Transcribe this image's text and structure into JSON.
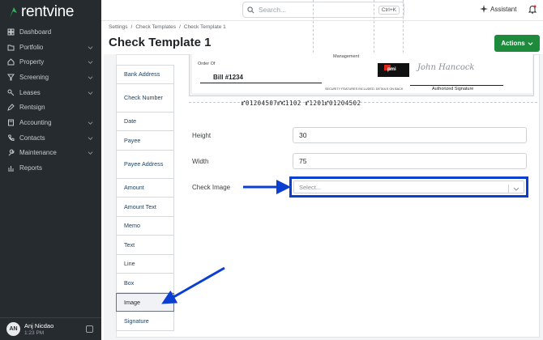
{
  "app": {
    "brand": "rentvine",
    "brand_color": "#1d8a3c",
    "accent_color": "#0b3fd1"
  },
  "sidebar": {
    "items": [
      {
        "label": "Dashboard",
        "icon": "grid-icon",
        "has_chevron": false
      },
      {
        "label": "Portfolio",
        "icon": "folder-icon",
        "has_chevron": true
      },
      {
        "label": "Property",
        "icon": "home-icon",
        "has_chevron": true
      },
      {
        "label": "Screening",
        "icon": "filter-icon",
        "has_chevron": true
      },
      {
        "label": "Leases",
        "icon": "key-icon",
        "has_chevron": true
      },
      {
        "label": "Rentsign",
        "icon": "pen-icon",
        "has_chevron": false
      },
      {
        "label": "Accounting",
        "icon": "calculator-icon",
        "has_chevron": true
      },
      {
        "label": "Contacts",
        "icon": "phone-icon",
        "has_chevron": true
      },
      {
        "label": "Maintenance",
        "icon": "wrench-icon",
        "has_chevron": true
      },
      {
        "label": "Reports",
        "icon": "chart-icon",
        "has_chevron": false
      }
    ],
    "user": {
      "initials": "AN",
      "name": "Anj Nicdao",
      "time": "1:23 PM"
    }
  },
  "header": {
    "search_placeholder": "Search...",
    "search_shortcut": "Ctrl+K",
    "assistant_label": "Assistant"
  },
  "breadcrumb": [
    "Settings",
    "/",
    "Check Templates",
    "/",
    "Check Template 1"
  ],
  "page": {
    "title": "Check Template 1",
    "actions_label": "Actions"
  },
  "fields": [
    {
      "label": "Bank Address",
      "tall": false,
      "selected": false
    },
    {
      "label": "Check Number",
      "tall": true,
      "selected": false
    },
    {
      "label": "Date",
      "tall": false,
      "selected": false
    },
    {
      "label": "Payee",
      "tall": false,
      "selected": false
    },
    {
      "label": "Payee Address",
      "tall": true,
      "selected": false
    },
    {
      "label": "Amount",
      "tall": false,
      "selected": false
    },
    {
      "label": "Amount Text",
      "tall": false,
      "selected": false
    },
    {
      "label": "Memo",
      "tall": false,
      "selected": false
    },
    {
      "label": "Text",
      "tall": false,
      "selected": false
    },
    {
      "label": "Line",
      "tall": false,
      "selected": false
    },
    {
      "label": "Box",
      "tall": false,
      "selected": false
    },
    {
      "label": "Image",
      "tall": false,
      "selected": true
    },
    {
      "label": "Signature",
      "tall": false,
      "selected": false
    }
  ],
  "check": {
    "order_of": "Order Of",
    "management": "Management",
    "bill": "Bill #1234",
    "logo_text": "pmi",
    "signature": "John Hancock",
    "authorized": "Authorized Signature",
    "security_note": "SECURITY FEATURES INCLUDED. DETAILS ON BACK",
    "micr": "⑈01204507⑈⑆1102 ⑈1201⑈01204502"
  },
  "form": {
    "height_label": "Height",
    "height_value": "30",
    "width_label": "Width",
    "width_value": "75",
    "image_label": "Check Image",
    "image_placeholder": "Select..."
  }
}
